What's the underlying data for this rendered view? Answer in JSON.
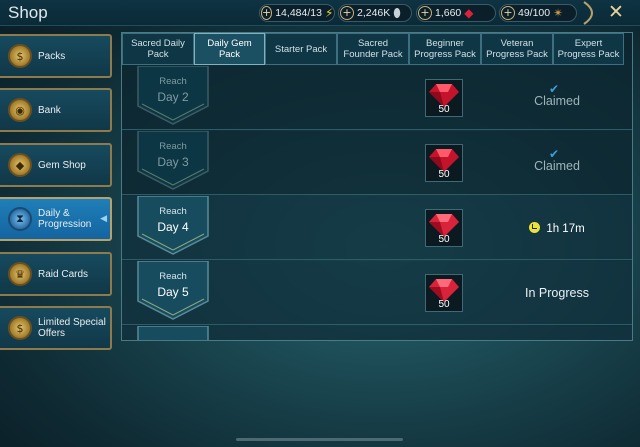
{
  "header": {
    "title": "Shop",
    "resources": [
      {
        "value": "14,484/13",
        "icon": "energy-icon",
        "color": "#e8d23a"
      },
      {
        "value": "2,246K",
        "icon": "silver-icon",
        "color": "#c8d2d8"
      },
      {
        "value": "1,660",
        "icon": "gem-icon",
        "color": "#d8233a"
      },
      {
        "value": "49/100",
        "icon": "arena-token-icon",
        "color": "#c89a4a"
      }
    ],
    "close_label": "✕"
  },
  "sidebar": {
    "items": [
      {
        "label": "Packs",
        "icon": "packs-icon",
        "active": false
      },
      {
        "label": "Bank",
        "icon": "bank-icon",
        "active": false
      },
      {
        "label": "Gem Shop",
        "icon": "gem-shop-icon",
        "active": false
      },
      {
        "label": "Daily & Progression",
        "icon": "hourglass-icon",
        "active": true
      },
      {
        "label": "Raid Cards",
        "icon": "crown-icon",
        "active": false
      },
      {
        "label": "Limited Special Offers",
        "icon": "offer-icon",
        "active": false
      }
    ]
  },
  "tabs": [
    {
      "label": "Sacred Daily Pack",
      "active": false
    },
    {
      "label": "Daily Gem Pack",
      "active": true
    },
    {
      "label": "Starter Pack",
      "active": false
    },
    {
      "label": "Sacred Founder Pack",
      "active": false
    },
    {
      "label": "Beginner Progress Pack",
      "active": false
    },
    {
      "label": "Veteran Progress Pack",
      "active": false
    },
    {
      "label": "Expert Progress Pack",
      "active": false
    }
  ],
  "rows": [
    {
      "reach": "Reach",
      "day": "Day 2",
      "reward_count": "50",
      "status": "Claimed",
      "state": "claimed"
    },
    {
      "reach": "Reach",
      "day": "Day 3",
      "reward_count": "50",
      "status": "Claimed",
      "state": "claimed"
    },
    {
      "reach": "Reach",
      "day": "Day 4",
      "reward_count": "50",
      "status": "1h 17m",
      "state": "timer"
    },
    {
      "reach": "Reach",
      "day": "Day 5",
      "reward_count": "50",
      "status": "In Progress",
      "state": "inprogress"
    }
  ],
  "colors": {
    "accent_gold": "#b7a06a",
    "active_blue": "#1f7fb8",
    "gem_red": "#d8233a",
    "timer_yellow": "#e9e33a",
    "claimed_check": "#3a9ed8"
  }
}
